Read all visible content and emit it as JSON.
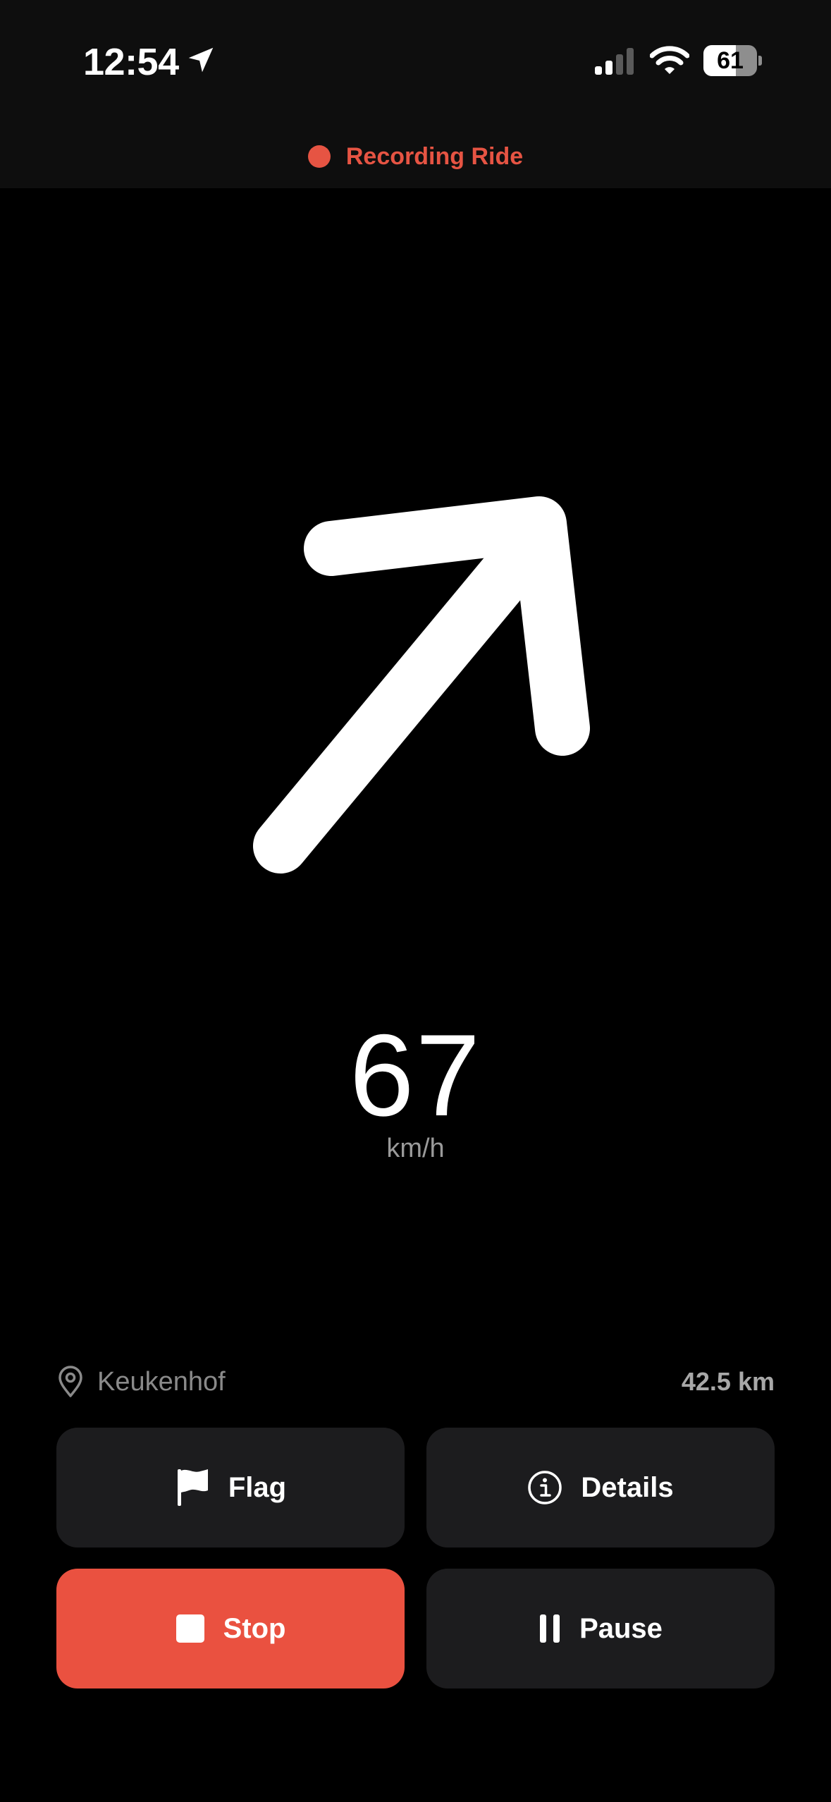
{
  "status_bar": {
    "time": "12:54",
    "battery_level": "61",
    "battery_fraction": 0.61,
    "icons": [
      "location-arrow-icon",
      "cellular-signal-icon",
      "wifi-icon",
      "battery-icon"
    ]
  },
  "recording": {
    "label": "Recording Ride",
    "color": "#e65443"
  },
  "direction": {
    "icon": "arrow-up-right-icon"
  },
  "speed": {
    "value": "67",
    "unit": "km/h"
  },
  "location": {
    "icon": "map-pin-icon",
    "name": "Keukenhof",
    "distance": "42.5 km"
  },
  "actions": {
    "flag": {
      "label": "Flag",
      "icon": "flag-icon"
    },
    "details": {
      "label": "Details",
      "icon": "info-icon"
    },
    "stop": {
      "label": "Stop",
      "icon": "stop-icon",
      "color": "#ea5140"
    },
    "pause": {
      "label": "Pause",
      "icon": "pause-icon"
    }
  }
}
